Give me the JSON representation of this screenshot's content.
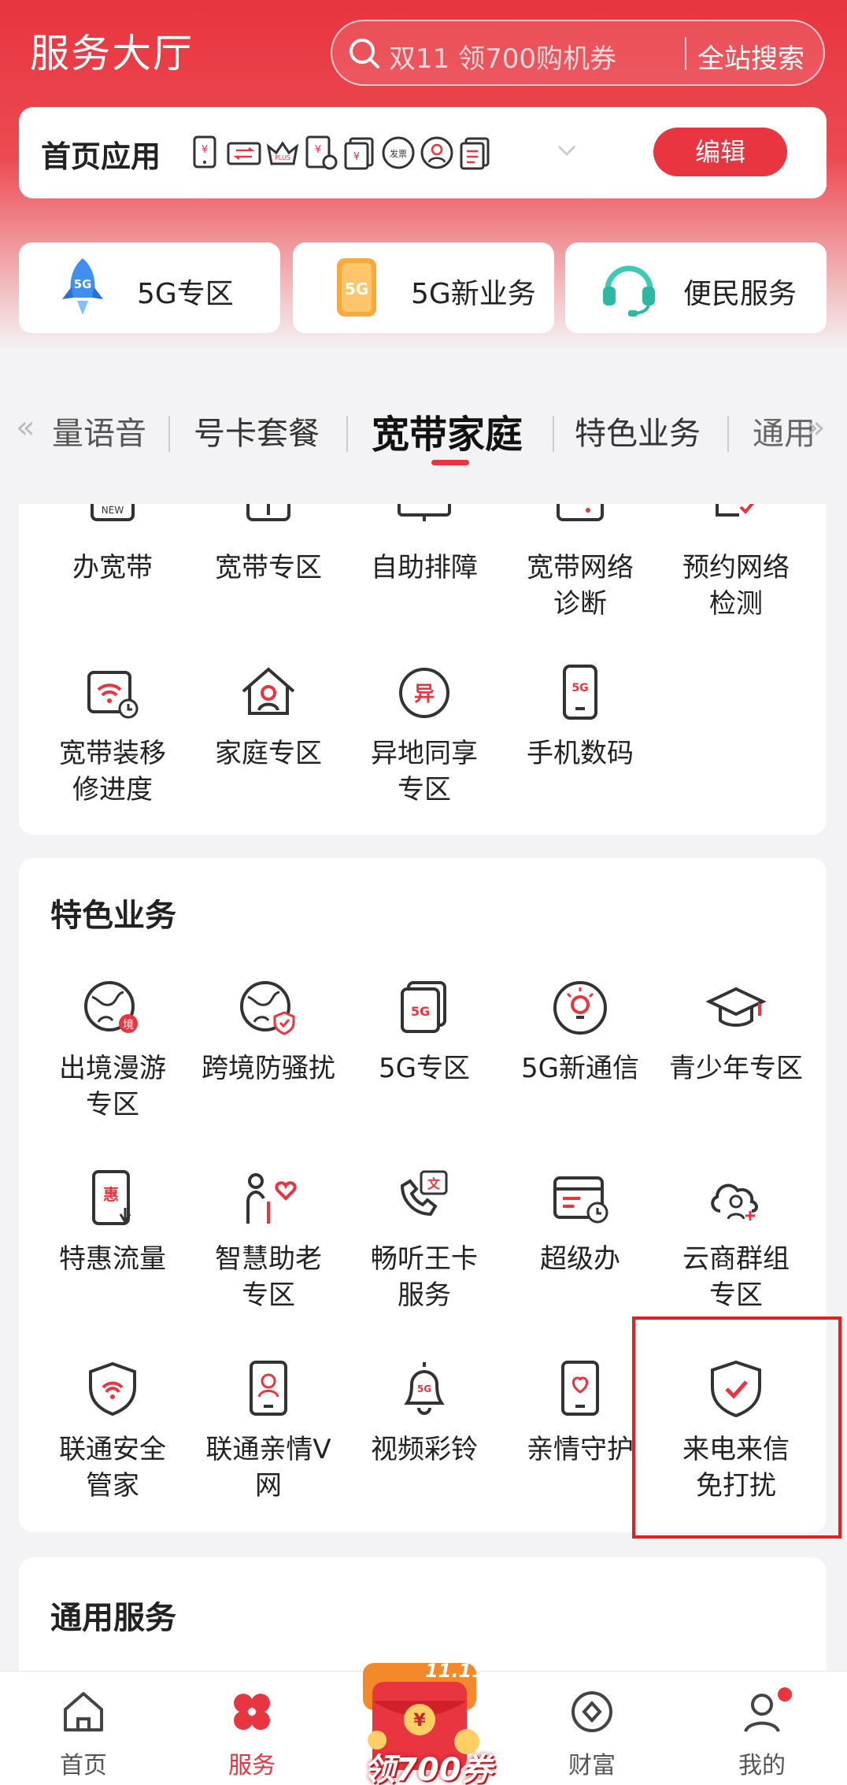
{
  "header": {
    "title": "服务大厅",
    "search_placeholder": "双11 领700购机券",
    "search_button": "全站搜索"
  },
  "home_apps": {
    "label": "首页应用",
    "edit_button": "编辑",
    "mini_icons": [
      "bill-icon",
      "transfer-icon",
      "plus-member-icon",
      "payment-record-icon",
      "balance-icon",
      "invoice-icon",
      "user-icon",
      "list-icon"
    ]
  },
  "zones": [
    {
      "label": "5G专区",
      "icon": "rocket-5g-icon",
      "badge": "5G"
    },
    {
      "label": "5G新业务",
      "icon": "phone-5g-icon",
      "badge": "5G"
    },
    {
      "label": "便民服务",
      "icon": "headset-icon"
    }
  ],
  "tabs": {
    "items": [
      "量语音",
      "号卡套餐",
      "宽带家庭",
      "特色业务",
      "通用"
    ],
    "active": "宽带家庭"
  },
  "broadband": {
    "items": [
      {
        "label": "办宽带",
        "icon": "new-broadband-icon"
      },
      {
        "label": "宽带专区",
        "icon": "broadband-zone-icon"
      },
      {
        "label": "自助排障",
        "icon": "monitor-icon"
      },
      {
        "label": "宽带网络诊断",
        "line1": "宽带网络",
        "line2": "诊断",
        "icon": "router-icon"
      },
      {
        "label": "预约网络检测",
        "line1": "预约网络",
        "line2": "检测",
        "icon": "appointment-icon"
      },
      {
        "label": "宽带装移修进度",
        "line1": "宽带装移",
        "line2": "修进度",
        "icon": "wifi-progress-icon"
      },
      {
        "label": "家庭专区",
        "icon": "home-icon"
      },
      {
        "label": "异地同享专区",
        "line1": "异地同享",
        "line2": "专区",
        "icon": "remote-share-icon",
        "glyph": "异"
      },
      {
        "label": "手机数码",
        "icon": "phone-5g-small-icon",
        "glyph": "5G"
      }
    ]
  },
  "special": {
    "title": "特色业务",
    "items": [
      {
        "line1": "出境漫游",
        "line2": "专区",
        "icon": "globe-roaming-icon",
        "glyph": "境"
      },
      {
        "line1": "跨境防骚扰",
        "line2": "",
        "icon": "globe-shield-icon"
      },
      {
        "line1": "5G专区",
        "line2": "",
        "icon": "5g-zone-icon",
        "glyph": "5G"
      },
      {
        "line1": "5G新通信",
        "line2": "",
        "icon": "bulb-icon"
      },
      {
        "line1": "青少年专区",
        "line2": "",
        "icon": "graduation-cap-icon"
      },
      {
        "line1": "特惠流量",
        "line2": "",
        "icon": "discount-data-icon",
        "glyph": "惠"
      },
      {
        "line1": "智慧助老",
        "line2": "专区",
        "icon": "elder-care-icon"
      },
      {
        "line1": "畅听王卡",
        "line2": "服务",
        "icon": "listen-card-icon",
        "glyph": "文"
      },
      {
        "line1": "超级办",
        "line2": "",
        "icon": "super-handle-icon"
      },
      {
        "line1": "云商群组",
        "line2": "专区",
        "icon": "cloud-group-icon"
      },
      {
        "line1": "联通安全",
        "line2": "管家",
        "icon": "security-shield-icon"
      },
      {
        "line1": "联通亲情V",
        "line2": "网",
        "icon": "family-network-icon"
      },
      {
        "line1": "视频彩铃",
        "line2": "",
        "icon": "bell-5g-icon",
        "glyph": "5G"
      },
      {
        "line1": "亲情守护",
        "line2": "",
        "icon": "family-guard-icon"
      },
      {
        "line1": "来电来信",
        "line2": "免打扰",
        "icon": "shield-check-icon"
      }
    ]
  },
  "general": {
    "title": "通用服务"
  },
  "bottom_nav": {
    "items": [
      {
        "label": "首页",
        "icon": "home-nav-icon"
      },
      {
        "label": "服务",
        "icon": "service-nav-icon",
        "active": true
      },
      {
        "label": "财富",
        "icon": "wealth-nav-icon"
      },
      {
        "label": "我的",
        "icon": "profile-nav-icon"
      }
    ],
    "promo": {
      "label": "领700券",
      "tag": "11.11"
    }
  },
  "colors": {
    "brand_red": "#e8353f",
    "highlight_box": "#e32020"
  }
}
